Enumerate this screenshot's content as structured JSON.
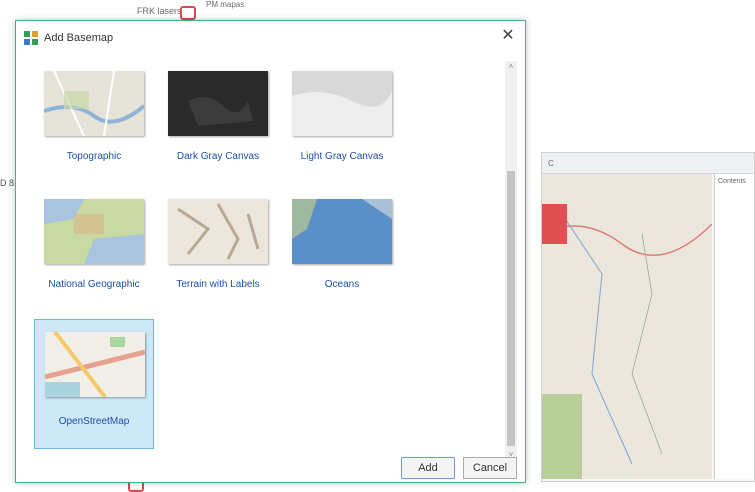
{
  "background": {
    "top_label": "FRK lasers",
    "top_label2": "PM mapas",
    "left_text": "D 8",
    "right_window": {
      "toolbar_text": "C",
      "side_text": "Contents"
    }
  },
  "dialog": {
    "title": "Add Basemap",
    "close_glyph": "✕",
    "basemaps": [
      {
        "label": "Topographic",
        "selected": false
      },
      {
        "label": "Dark Gray Canvas",
        "selected": false
      },
      {
        "label": "Light Gray Canvas",
        "selected": false
      },
      {
        "label": "National Geographic",
        "selected": false
      },
      {
        "label": "Terrain with Labels",
        "selected": false
      },
      {
        "label": "Oceans",
        "selected": false
      },
      {
        "label": "OpenStreetMap",
        "selected": true
      }
    ],
    "scroll_up_glyph": "˄",
    "scroll_down_glyph": "˅",
    "buttons": {
      "add": "Add",
      "cancel": "Cancel"
    }
  },
  "colors": {
    "accent": "#4caf8f",
    "selection": "#cde8f6",
    "link": "#1b4fa8"
  }
}
